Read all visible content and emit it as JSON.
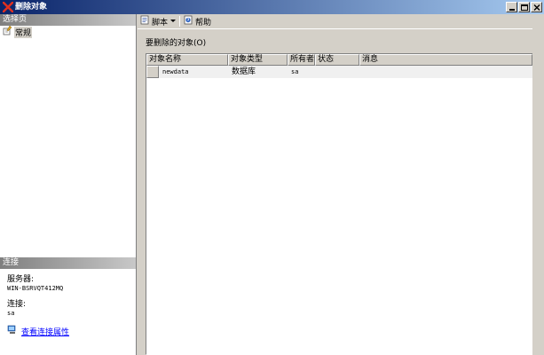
{
  "window": {
    "title": "删除对象"
  },
  "left": {
    "select_page_header": "选择页",
    "nav_items": [
      {
        "label": "常规"
      }
    ],
    "connection_header": "连接",
    "server_label": "服务器:",
    "server_value": "WIN-BSRVQT412MQ",
    "connection_label": "连接:",
    "connection_value": "sa",
    "view_properties_link": "查看连接属性"
  },
  "toolbar": {
    "script_label": "脚本",
    "help_label": "帮助"
  },
  "main": {
    "objects_label": "要删除的对象(O)",
    "grid": {
      "columns": [
        "对象名称",
        "对象类型",
        "所有者",
        "状态",
        "消息"
      ],
      "rows": [
        {
          "name": "newdata",
          "type": "数据库",
          "owner": "sa",
          "status": "",
          "message": ""
        }
      ]
    }
  },
  "icons": {
    "title": "delete-x-icon",
    "nav": "page-icon",
    "script": "script-icon",
    "help": "help-icon",
    "link": "connection-properties-icon"
  },
  "colors": {
    "titlebar_start": "#0a246a",
    "titlebar_end": "#a6caf0",
    "link": "#0000ff",
    "face": "#d4d0c8"
  }
}
